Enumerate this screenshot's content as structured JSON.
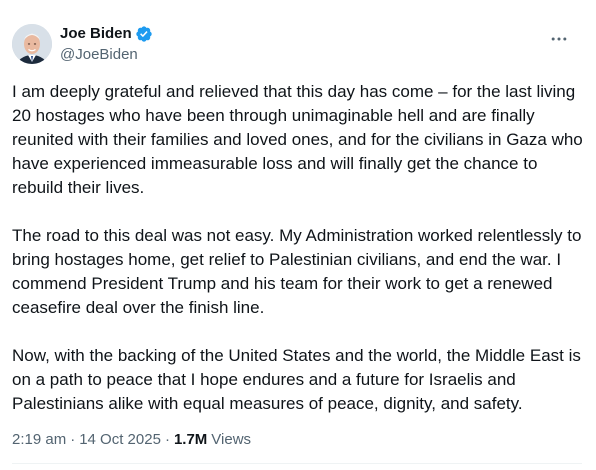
{
  "author": {
    "display_name": "Joe Biden",
    "handle": "@JoeBiden",
    "verified": true,
    "verified_color": "#1d9bf0"
  },
  "tweet": {
    "paragraphs": [
      "I am deeply grateful and relieved that this day has come – for the last living 20 hostages who have been through unimaginable hell and are finally reunited with their families and loved ones, and for the civilians in Gaza who have experienced immeasurable loss and will finally get the chance to rebuild their lives.",
      "The road to this deal was not easy. My Administration worked relentlessly to bring hostages home, get relief to Palestinian civilians, and end the war. I commend President Trump and his team for their work to get a renewed ceasefire deal over the finish line.",
      "Now, with the backing of the United States and the world, the Middle East is on a path to peace that I hope endures and a future for Israelis and Palestinians alike with equal measures of peace, dignity, and safety."
    ]
  },
  "meta": {
    "time": "2:19 am",
    "separator": "·",
    "date": "14 Oct 2025",
    "views_count": "1.7M",
    "views_label": "Views"
  },
  "icons": {
    "more": "more-horizontal-icon",
    "verified": "verified-badge-icon"
  },
  "colors": {
    "text_primary": "#0f1419",
    "text_secondary": "#536471",
    "divider": "#eff3f4"
  }
}
